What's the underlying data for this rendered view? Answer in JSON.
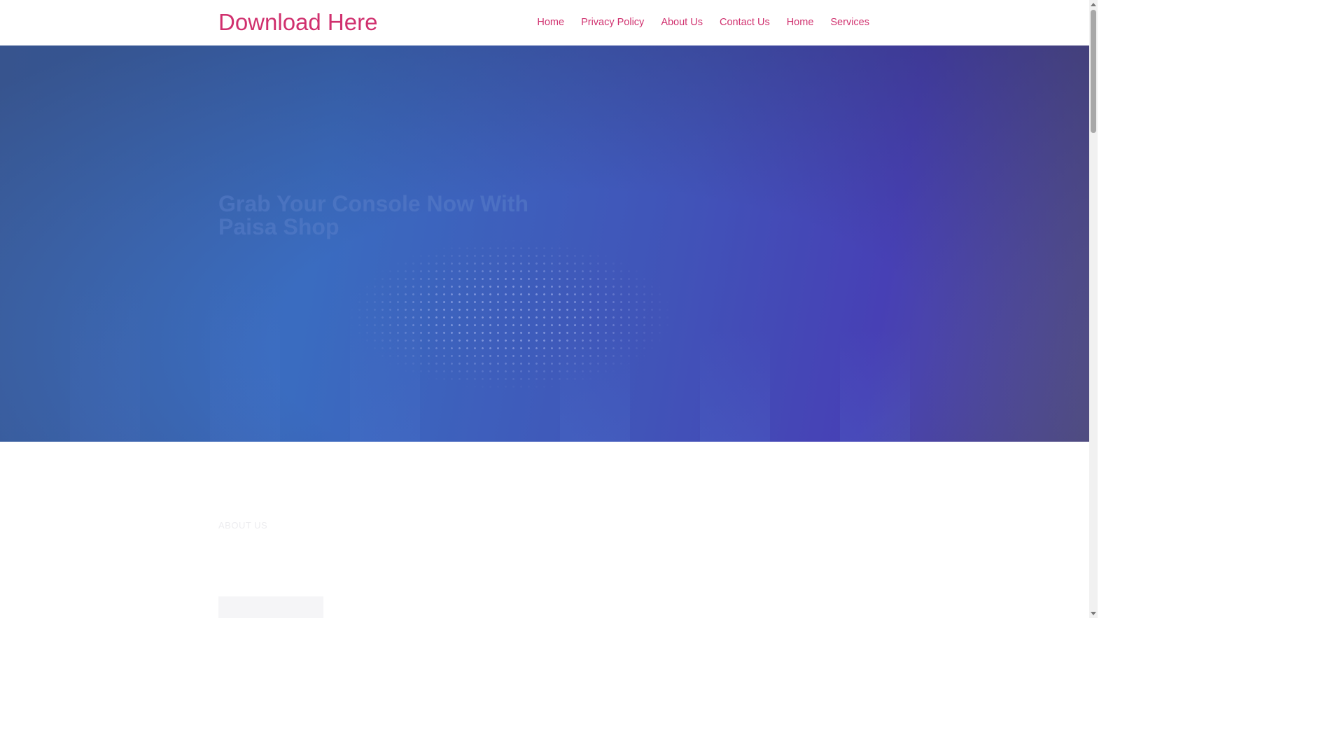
{
  "header": {
    "brand": "Download Here",
    "nav": [
      {
        "label": "Home"
      },
      {
        "label": "Privacy Policy"
      },
      {
        "label": "About Us"
      },
      {
        "label": "Contact Us"
      },
      {
        "label": "Home"
      },
      {
        "label": "Services"
      }
    ]
  },
  "hero": {
    "title": "Grab Your Console Now With Paisa Shop",
    "text": ""
  },
  "about": {
    "label": "ABOUT US",
    "heading": "",
    "button_label": ""
  },
  "colors": {
    "brand": "#d0306e",
    "hero_start": "#3f6cb5",
    "hero_end": "#56528a"
  },
  "scroll": {
    "position_fraction": 0.0
  }
}
